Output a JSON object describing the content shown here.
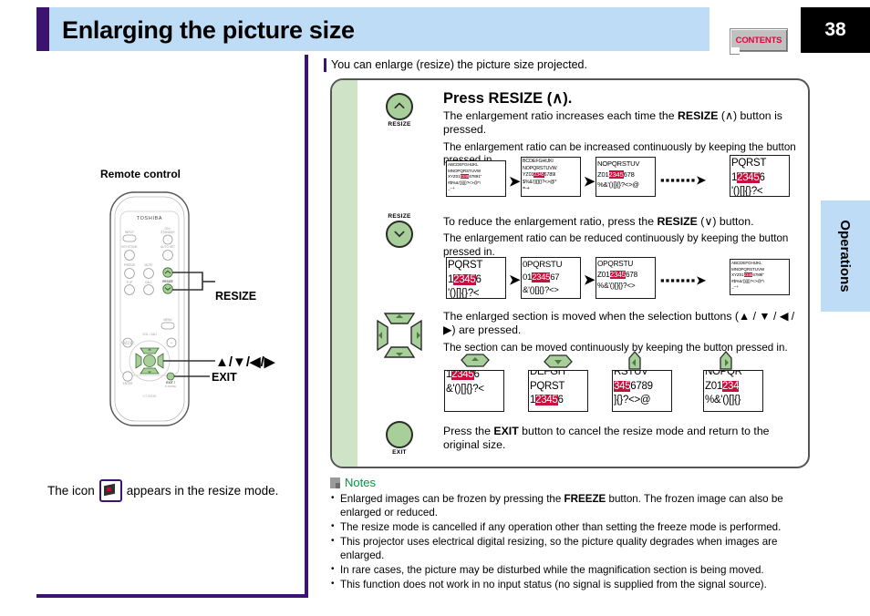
{
  "header": {
    "title": "Enlarging the picture size",
    "contents_label": "CONTENTS",
    "page_number": "38",
    "accent_color": "#3c1470",
    "band_color": "#bedcf5",
    "contents_text_color": "#e8003c"
  },
  "side_tab": {
    "label": "Operations"
  },
  "left_panel": {
    "remote_caption": "Remote control",
    "icon_note_before": "The icon",
    "icon_note_after": "appears in the resize mode.",
    "icon_name": "resize-mode-icon",
    "callouts": [
      {
        "label": "RESIZE"
      },
      {
        "label": "▲/▼/◀/▶"
      },
      {
        "label": "EXIT"
      }
    ],
    "remote_buttons": [
      "TOSHIBA",
      "ON/ STANDBY",
      "INPUT",
      "KEYSTONE",
      "AUTO SET",
      "FREEZE",
      "MUTE",
      "RESIZE",
      "P-IP",
      "CALL",
      "MENU",
      "VOL / ADJ",
      "ENTER",
      "EXIT / P-MODE",
      "CT-90190"
    ]
  },
  "main": {
    "intro": "You can enlarge (resize) the picture size projected.",
    "steps": [
      {
        "icon_label": "RESIZE",
        "icon_name": "resize-up-button-icon",
        "chevron": "up",
        "title": "Press RESIZE (∧).",
        "text_a": "The enlargement ratio increases each time the ",
        "text_bold": "RESIZE",
        "text_b": " (∧) button is pressed.",
        "sub": "The enlargement ratio can be increased continuously by keeping the button pressed in."
      },
      {
        "icon_label": "RESIZE",
        "icon_name": "resize-down-button-icon",
        "chevron": "down",
        "text_a": "To reduce the enlargement ratio, press the ",
        "text_bold": "RESIZE",
        "text_b": " (∨) button.",
        "sub": "The enlargement ratio can be reduced continuously by keeping the button pressed in."
      },
      {
        "icon_name": "direction-pad-icon",
        "text_a": "The enlarged section is moved when the selection buttons (▲ / ▼ / ◀ / ▶) are pressed.",
        "sub": "The section can be moved continuously by keeping the button pressed in."
      },
      {
        "icon_label": "EXIT",
        "icon_name": "exit-button-icon",
        "text_a": "Press the ",
        "text_bold": "EXIT",
        "text_b": " button to cancel the resize mode and return to the original size."
      }
    ],
    "enlarge_sequence": {
      "arrow": "➡",
      "dots": "▪▪▪▪▪▪▪➡",
      "frames": [
        {
          "zoom": "1x",
          "rows": [
            "ABCDEFGHIJKL",
            "MNOPQRSTUVW",
            "XYZ01|2345|67891\"",
            "#$%&'()[]{}?<>@*\\",
            "_−+"
          ],
          "highlight": "2345"
        },
        {
          "zoom": "1.3x",
          "rows": [
            "BCDEFGHIJKl",
            "NOPQRSTUVW",
            "YZ01|2345|6789l",
            "$%&'()[]{}?<>@*",
            "=-+"
          ],
          "highlight": "2345"
        },
        {
          "zoom": "1.6x",
          "rows": [
            "NOPQRSTUV",
            "Z01|2345|678",
            "%&'()[]{}?<>@"
          ],
          "highlight": "2345"
        },
        {
          "zoom": "2x",
          "rows": [
            "PQRST",
            "1|23456",
            "'()[]{}?<"
          ],
          "highlight": "2345"
        }
      ]
    },
    "reduce_sequence": {
      "arrow": "➡",
      "dots": "▪▪▪▪▪▪▪➡",
      "frames": [
        {
          "zoom": "2x",
          "rows": [
            "PQRST",
            "1|23456",
            "'()[]{}?<"
          ],
          "highlight": "2345"
        },
        {
          "zoom": "1.6x",
          "rows": [
            "0PQRSTU",
            "01|2345|67",
            "&'()[]{}?<>"
          ],
          "highlight": "2345"
        },
        {
          "zoom": "1.3x",
          "rows": [
            "OPQRSTU",
            "Z01|2345|678",
            "%&'()[]{}?<>"
          ],
          "highlight": "2345"
        },
        {
          "zoom": "1x",
          "rows": [
            "ABCDEFGHIJKL",
            "MNOPQRSTUVW",
            "XYZ01|2345|6789l\"",
            "#$%&'()[]{}?<>@*\\",
            "_−+"
          ],
          "highlight": "2345"
        }
      ]
    },
    "move_sequence": {
      "frames": [
        {
          "direction": "up",
          "direction_icon": "arrow-up-pad-icon",
          "rows": [
            "1|23456",
            "&'()[]{}?<"
          ],
          "highlight": "2345"
        },
        {
          "direction": "down",
          "direction_icon": "arrow-down-pad-icon",
          "rows": [
            "DEFGH",
            "PQRST",
            "1|23456"
          ],
          "highlight": "2345"
        },
        {
          "direction": "left",
          "direction_icon": "arrow-left-pad-icon",
          "rows": [
            "RSTUV",
            "|345|6789",
            "]{}?<>@"
          ],
          "highlight": "345"
        },
        {
          "direction": "right",
          "direction_icon": "arrow-right-pad-icon",
          "rows": [
            "NOPQR",
            "Z01|234|",
            "%&'()[]{}"
          ],
          "highlight": "234"
        }
      ]
    }
  },
  "notes": {
    "title": "Notes",
    "items": [
      {
        "pre": "Enlarged images can be frozen by pressing the ",
        "bold": "FREEZE",
        "post": " button. The frozen image can also be enlarged or reduced."
      },
      {
        "pre": "The resize mode is cancelled if any operation other than setting the freeze mode is performed.",
        "bold": "",
        "post": ""
      },
      {
        "pre": "This projector uses electrical digital resizing, so the picture quality degrades when images are enlarged.",
        "bold": "",
        "post": ""
      },
      {
        "pre": "In rare cases, the picture may be disturbed while the magnification section is being moved.",
        "bold": "",
        "post": ""
      },
      {
        "pre": "This function does not work in no input status (no signal is supplied from the signal source).",
        "bold": "",
        "post": ""
      }
    ]
  },
  "colors": {
    "highlight_red": "#c8103c",
    "button_green": "#a8cf9a",
    "stripe_green": "#cfe3c7",
    "notes_green": "#009a3d"
  }
}
